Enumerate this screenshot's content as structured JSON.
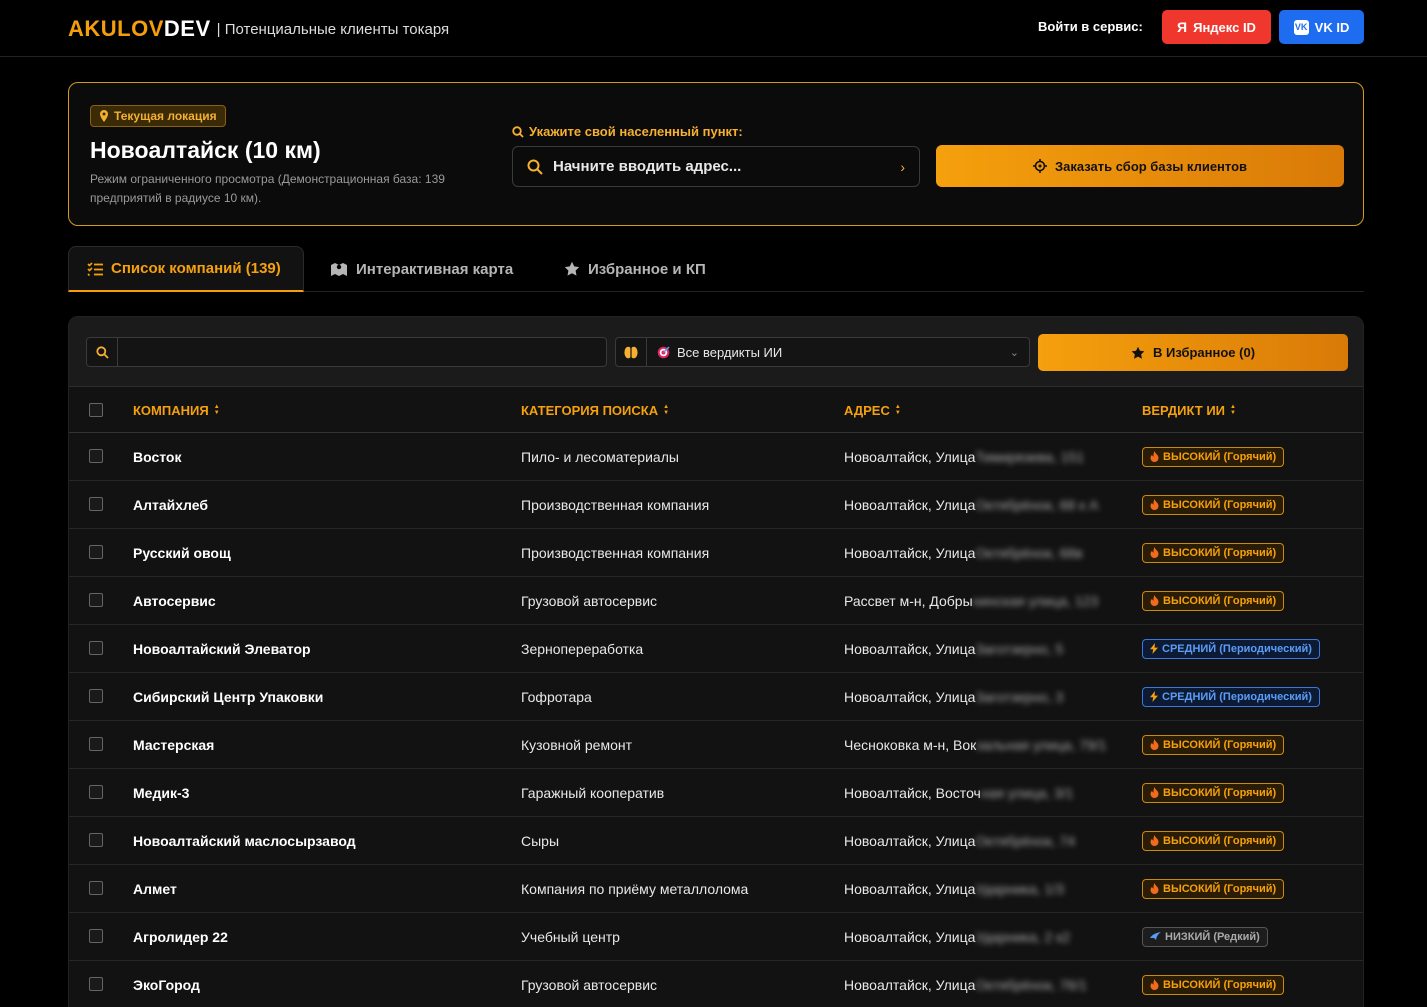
{
  "header": {
    "brand_a": "AKULOV",
    "brand_b": "DEV",
    "subtitle": "| Потенциальные клиенты токаря",
    "login_label": "Войти в сервис:",
    "yandex_label": "Яндекс ID",
    "vk_label": "VK ID"
  },
  "location": {
    "badge": "Текущая локация",
    "title": "Новоалтайск (10 км)",
    "description": "Режим ограниченного просмотра (Демонстрационная база: 139 предприятий в радиусе 10 км).",
    "address_label": "Укажите свой населенный пункт:",
    "address_placeholder": "Начните вводить адрес...",
    "order_button": "Заказать сбор базы клиентов"
  },
  "tabs": [
    {
      "label": "Список компаний (139)",
      "active": true
    },
    {
      "label": "Интерактивная карта",
      "active": false
    },
    {
      "label": "Избранное и КП",
      "active": false
    }
  ],
  "toolbar": {
    "search_value": "",
    "verdict_filter": "Все вердикты ИИ",
    "favorites_button": "В Избранное (0)"
  },
  "table": {
    "columns": [
      "КОМПАНИЯ",
      "КАТЕГОРИЯ ПОИСКА",
      "АДРЕС",
      "ВЕРДИКТ ИИ"
    ],
    "rows": [
      {
        "company": "Восток",
        "category": "Пило- и лесоматериалы",
        "address": "Новоалтайск, Улица",
        "address_hidden": "Тимирязева, 151",
        "verdict": "ВЫСОКИЙ (Горячий)",
        "level": "high"
      },
      {
        "company": "Алтайхлеб",
        "category": "Производственная компания",
        "address": "Новоалтайск, Улица",
        "address_hidden": "Октябрёнок, 68 к А",
        "verdict": "ВЫСОКИЙ (Горячий)",
        "level": "high"
      },
      {
        "company": "Русский овощ",
        "category": "Производственная компания",
        "address": "Новоалтайск, Улица",
        "address_hidden": "Октябрёнок, 68в",
        "verdict": "ВЫСОКИЙ (Горячий)",
        "level": "high"
      },
      {
        "company": "Автосервис",
        "category": "Грузовой автосервис",
        "address": "Рассвет м-н, Добры",
        "address_hidden": "нинская улица, 123",
        "verdict": "ВЫСОКИЙ (Горячий)",
        "level": "high"
      },
      {
        "company": "Новоалтайский Элеватор",
        "category": "Зернопереработка",
        "address": "Новоалтайск, Улица",
        "address_hidden": "Заготзерно, 5",
        "verdict": "СРЕДНИЙ (Периодический)",
        "level": "mid"
      },
      {
        "company": "Сибирский Центр Упаковки",
        "category": "Гофротара",
        "address": "Новоалтайск, Улица",
        "address_hidden": "Заготзерно, 3",
        "verdict": "СРЕДНИЙ (Периодический)",
        "level": "mid"
      },
      {
        "company": "Мастерская",
        "category": "Кузовной ремонт",
        "address": "Чесноковка м-н, Вок",
        "address_hidden": "зальная улица, 79/1",
        "verdict": "ВЫСОКИЙ (Горячий)",
        "level": "high"
      },
      {
        "company": "Медик-3",
        "category": "Гаражный кооператив",
        "address": "Новоалтайск, Восточ",
        "address_hidden": "ная улица, 3/1",
        "verdict": "ВЫСОКИЙ (Горячий)",
        "level": "high"
      },
      {
        "company": "Новоалтайский маслосырзавод",
        "category": "Сыры",
        "address": "Новоалтайск, Улица",
        "address_hidden": "Октябрёнок, 74",
        "verdict": "ВЫСОКИЙ (Горячий)",
        "level": "high"
      },
      {
        "company": "Алмет",
        "category": "Компания по приёму металлолома",
        "address": "Новоалтайск, Улица",
        "address_hidden": "Ударника, 1/3",
        "verdict": "ВЫСОКИЙ (Горячий)",
        "level": "high"
      },
      {
        "company": "Агролидер 22",
        "category": "Учебный центр",
        "address": "Новоалтайск, Улица",
        "address_hidden": "Ударника, 2 к2",
        "verdict": "НИЗКИЙ (Редкий)",
        "level": "low"
      },
      {
        "company": "ЭкоГород",
        "category": "Грузовой автосервис",
        "address": "Новоалтайск, Улица",
        "address_hidden": "Октябрёнок, 76/1",
        "verdict": "ВЫСОКИЙ (Горячий)",
        "level": "high"
      }
    ]
  },
  "colors": {
    "accent": "#f59e0b",
    "yandex": "#f0372d",
    "vk": "#1e6cf0",
    "badge_high": "#f5a00d",
    "badge_mid": "#5a9cf5",
    "badge_low": "#aaaaaa"
  },
  "icons": {
    "location": "map-pin-icon",
    "search": "search-icon",
    "order": "target-icon",
    "list": "list-check-icon",
    "map": "map-icon",
    "favorites": "star-icon",
    "ai": "brain-icon",
    "high": "fire-icon",
    "mid": "lightning-icon",
    "low": "snowflake-icon"
  }
}
